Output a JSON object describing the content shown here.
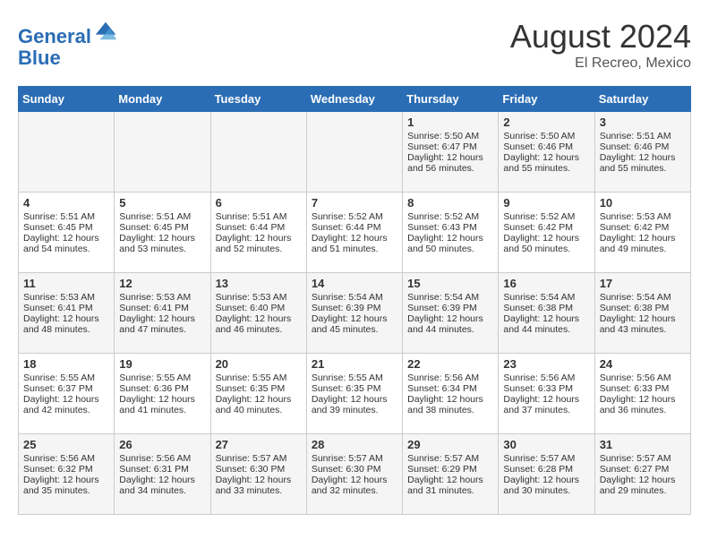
{
  "header": {
    "logo_line1": "General",
    "logo_line2": "Blue",
    "month_year": "August 2024",
    "location": "El Recreo, Mexico"
  },
  "days_of_week": [
    "Sunday",
    "Monday",
    "Tuesday",
    "Wednesday",
    "Thursday",
    "Friday",
    "Saturday"
  ],
  "weeks": [
    [
      {
        "day": "",
        "info": ""
      },
      {
        "day": "",
        "info": ""
      },
      {
        "day": "",
        "info": ""
      },
      {
        "day": "",
        "info": ""
      },
      {
        "day": "1",
        "info": "Sunrise: 5:50 AM\nSunset: 6:47 PM\nDaylight: 12 hours and 56 minutes."
      },
      {
        "day": "2",
        "info": "Sunrise: 5:50 AM\nSunset: 6:46 PM\nDaylight: 12 hours and 55 minutes."
      },
      {
        "day": "3",
        "info": "Sunrise: 5:51 AM\nSunset: 6:46 PM\nDaylight: 12 hours and 55 minutes."
      }
    ],
    [
      {
        "day": "4",
        "info": "Sunrise: 5:51 AM\nSunset: 6:45 PM\nDaylight: 12 hours and 54 minutes."
      },
      {
        "day": "5",
        "info": "Sunrise: 5:51 AM\nSunset: 6:45 PM\nDaylight: 12 hours and 53 minutes."
      },
      {
        "day": "6",
        "info": "Sunrise: 5:51 AM\nSunset: 6:44 PM\nDaylight: 12 hours and 52 minutes."
      },
      {
        "day": "7",
        "info": "Sunrise: 5:52 AM\nSunset: 6:44 PM\nDaylight: 12 hours and 51 minutes."
      },
      {
        "day": "8",
        "info": "Sunrise: 5:52 AM\nSunset: 6:43 PM\nDaylight: 12 hours and 50 minutes."
      },
      {
        "day": "9",
        "info": "Sunrise: 5:52 AM\nSunset: 6:42 PM\nDaylight: 12 hours and 50 minutes."
      },
      {
        "day": "10",
        "info": "Sunrise: 5:53 AM\nSunset: 6:42 PM\nDaylight: 12 hours and 49 minutes."
      }
    ],
    [
      {
        "day": "11",
        "info": "Sunrise: 5:53 AM\nSunset: 6:41 PM\nDaylight: 12 hours and 48 minutes."
      },
      {
        "day": "12",
        "info": "Sunrise: 5:53 AM\nSunset: 6:41 PM\nDaylight: 12 hours and 47 minutes."
      },
      {
        "day": "13",
        "info": "Sunrise: 5:53 AM\nSunset: 6:40 PM\nDaylight: 12 hours and 46 minutes."
      },
      {
        "day": "14",
        "info": "Sunrise: 5:54 AM\nSunset: 6:39 PM\nDaylight: 12 hours and 45 minutes."
      },
      {
        "day": "15",
        "info": "Sunrise: 5:54 AM\nSunset: 6:39 PM\nDaylight: 12 hours and 44 minutes."
      },
      {
        "day": "16",
        "info": "Sunrise: 5:54 AM\nSunset: 6:38 PM\nDaylight: 12 hours and 44 minutes."
      },
      {
        "day": "17",
        "info": "Sunrise: 5:54 AM\nSunset: 6:38 PM\nDaylight: 12 hours and 43 minutes."
      }
    ],
    [
      {
        "day": "18",
        "info": "Sunrise: 5:55 AM\nSunset: 6:37 PM\nDaylight: 12 hours and 42 minutes."
      },
      {
        "day": "19",
        "info": "Sunrise: 5:55 AM\nSunset: 6:36 PM\nDaylight: 12 hours and 41 minutes."
      },
      {
        "day": "20",
        "info": "Sunrise: 5:55 AM\nSunset: 6:35 PM\nDaylight: 12 hours and 40 minutes."
      },
      {
        "day": "21",
        "info": "Sunrise: 5:55 AM\nSunset: 6:35 PM\nDaylight: 12 hours and 39 minutes."
      },
      {
        "day": "22",
        "info": "Sunrise: 5:56 AM\nSunset: 6:34 PM\nDaylight: 12 hours and 38 minutes."
      },
      {
        "day": "23",
        "info": "Sunrise: 5:56 AM\nSunset: 6:33 PM\nDaylight: 12 hours and 37 minutes."
      },
      {
        "day": "24",
        "info": "Sunrise: 5:56 AM\nSunset: 6:33 PM\nDaylight: 12 hours and 36 minutes."
      }
    ],
    [
      {
        "day": "25",
        "info": "Sunrise: 5:56 AM\nSunset: 6:32 PM\nDaylight: 12 hours and 35 minutes."
      },
      {
        "day": "26",
        "info": "Sunrise: 5:56 AM\nSunset: 6:31 PM\nDaylight: 12 hours and 34 minutes."
      },
      {
        "day": "27",
        "info": "Sunrise: 5:57 AM\nSunset: 6:30 PM\nDaylight: 12 hours and 33 minutes."
      },
      {
        "day": "28",
        "info": "Sunrise: 5:57 AM\nSunset: 6:30 PM\nDaylight: 12 hours and 32 minutes."
      },
      {
        "day": "29",
        "info": "Sunrise: 5:57 AM\nSunset: 6:29 PM\nDaylight: 12 hours and 31 minutes."
      },
      {
        "day": "30",
        "info": "Sunrise: 5:57 AM\nSunset: 6:28 PM\nDaylight: 12 hours and 30 minutes."
      },
      {
        "day": "31",
        "info": "Sunrise: 5:57 AM\nSunset: 6:27 PM\nDaylight: 12 hours and 29 minutes."
      }
    ]
  ]
}
